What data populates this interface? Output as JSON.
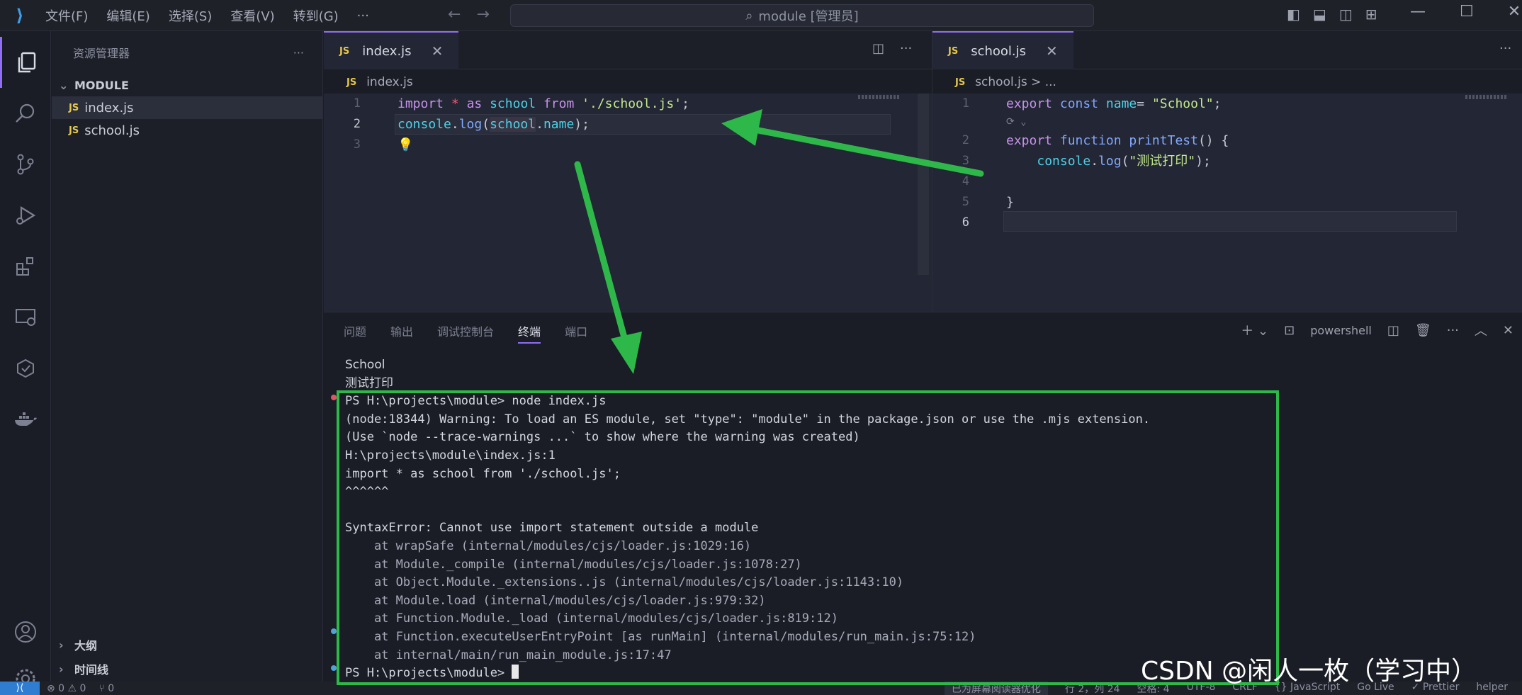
{
  "titlebar": {
    "menu": [
      "文件(F)",
      "编辑(E)",
      "选择(S)",
      "查看(V)",
      "转到(G)",
      "···"
    ],
    "search_text": "module [管理员]"
  },
  "sidebar": {
    "title": "资源管理器",
    "more": "···",
    "folder": "MODULE",
    "files": [
      {
        "name": "index.js",
        "badge": "JS"
      },
      {
        "name": "school.js",
        "badge": "JS"
      }
    ],
    "outline": "大纲",
    "timeline": "时间线"
  },
  "editor_left": {
    "tab_label": "index.js",
    "tab_badge": "JS",
    "breadcrumb": "index.js",
    "line_numbers": [
      "1",
      "2",
      "3"
    ]
  },
  "editor_right": {
    "tab_label": "school.js",
    "tab_badge": "JS",
    "breadcrumb": "school.js > ...",
    "line_numbers": [
      "1",
      "2",
      "3",
      "4",
      "5",
      "6"
    ]
  },
  "panel": {
    "tabs": [
      "问题",
      "输出",
      "调试控制台",
      "终端",
      "端口"
    ],
    "active_tab": "终端",
    "shell": "powershell",
    "terminal_lines": [
      "School",
      "测试打印",
      "PS H:\\projects\\module> node index.js",
      "(node:18344) Warning: To load an ES module, set \"type\": \"module\" in the package.json or use the .mjs extension.",
      "(Use `node --trace-warnings ...` to show where the warning was created)",
      "H:\\projects\\module\\index.js:1",
      "import * as school from './school.js';",
      "^^^^^^",
      "",
      "SyntaxError: Cannot use import statement outside a module",
      "    at wrapSafe (internal/modules/cjs/loader.js:1029:16)",
      "    at Module._compile (internal/modules/cjs/loader.js:1078:27)",
      "    at Object.Module._extensions..js (internal/modules/cjs/loader.js:1143:10)",
      "    at Module.load (internal/modules/cjs/loader.js:979:32)",
      "    at Function.Module._load (internal/modules/cjs/loader.js:819:12)",
      "    at Function.executeUserEntryPoint [as runMain] (internal/modules/run_main.js:75:12)",
      "    at internal/main/run_main_module.js:17:47"
    ],
    "prompt": "PS H:\\projects\\module> "
  },
  "statusbar": {
    "errors": "⊗ 0 ⚠ 0",
    "ports": "⑂ 0",
    "right": [
      "已为屏幕阅读器优化",
      "行 2，列 24",
      "空格: 4",
      "UTF-8",
      "CRLF",
      "{} JavaScript",
      "Go Live",
      "✓ Prettier",
      "helper"
    ]
  },
  "watermark": "CSDN @闲人一枚（学习中）",
  "colors": {
    "accent": "#8f6df4",
    "annotation": "#2fb84a",
    "js_badge": "#e6c84c"
  }
}
